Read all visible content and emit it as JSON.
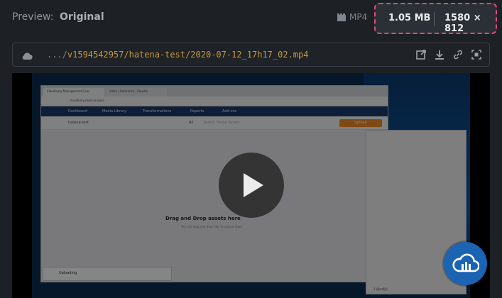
{
  "header": {
    "preview_label": "Preview:",
    "preview_value": "Original",
    "format_icon": "video-file-icon",
    "format": "MP4",
    "file_size": "1.05 MB",
    "dimensions": "1580 × 812"
  },
  "urlbar": {
    "prefix": ".../",
    "path": "v1594542957/hatena-test/2020-07-12_17h17_02.mp4",
    "icons": [
      "open-in-new-icon",
      "download-icon",
      "link-icon",
      "focus-frame-icon"
    ]
  },
  "video": {
    "tab1": "Cloudinary Management Cons",
    "tab2": "Video | Reference | Cloudin",
    "address": "cloudinary.com/console/...",
    "nav": [
      "Dashboard",
      "Media Library",
      "Transformations",
      "Reports",
      "Add-ons"
    ],
    "folder": "hatena-test",
    "filter": "All",
    "search_placeholder": "Search Media Assets",
    "upload": "Upload",
    "drop_title": "Drag and Drop assets here",
    "drop_sub": "You can drag and drop files to upload them",
    "uploading": "Uploading",
    "explorer_status": "2 個の項目"
  },
  "colors": {
    "accent": "#e5487a",
    "path": "#c49a3f",
    "fab": "#1b63b3"
  }
}
